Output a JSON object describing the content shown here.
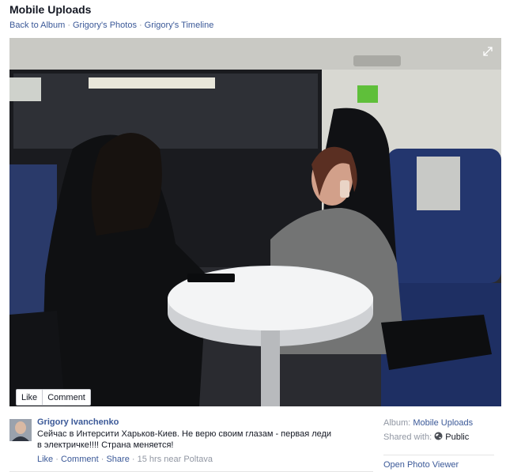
{
  "header": {
    "title": "Mobile Uploads",
    "breadcrumbs": [
      "Back to Album",
      "Grigory's Photos",
      "Grigory's Timeline"
    ],
    "separator": "·"
  },
  "photo": {
    "like_label": "Like",
    "comment_label": "Comment"
  },
  "post": {
    "author": "Grigory Ivanchenko",
    "message": "Сейчас в Интерсити Харьков-Киев. Не верю своим глазам - первая леди в электричке!!!! Страна меняется!",
    "actions": {
      "like": "Like",
      "comment": "Comment",
      "share": "Share",
      "meta": "15 hrs near Poltava",
      "separator": "·"
    }
  },
  "sidebar": {
    "album_label": "Album:",
    "album_value": "Mobile Uploads",
    "shared_label": "Shared with:",
    "shared_value": "Public",
    "open_viewer": "Open Photo Viewer"
  },
  "colors": {
    "link": "#3b5998",
    "muted": "#9197a3",
    "text": "#141823"
  }
}
